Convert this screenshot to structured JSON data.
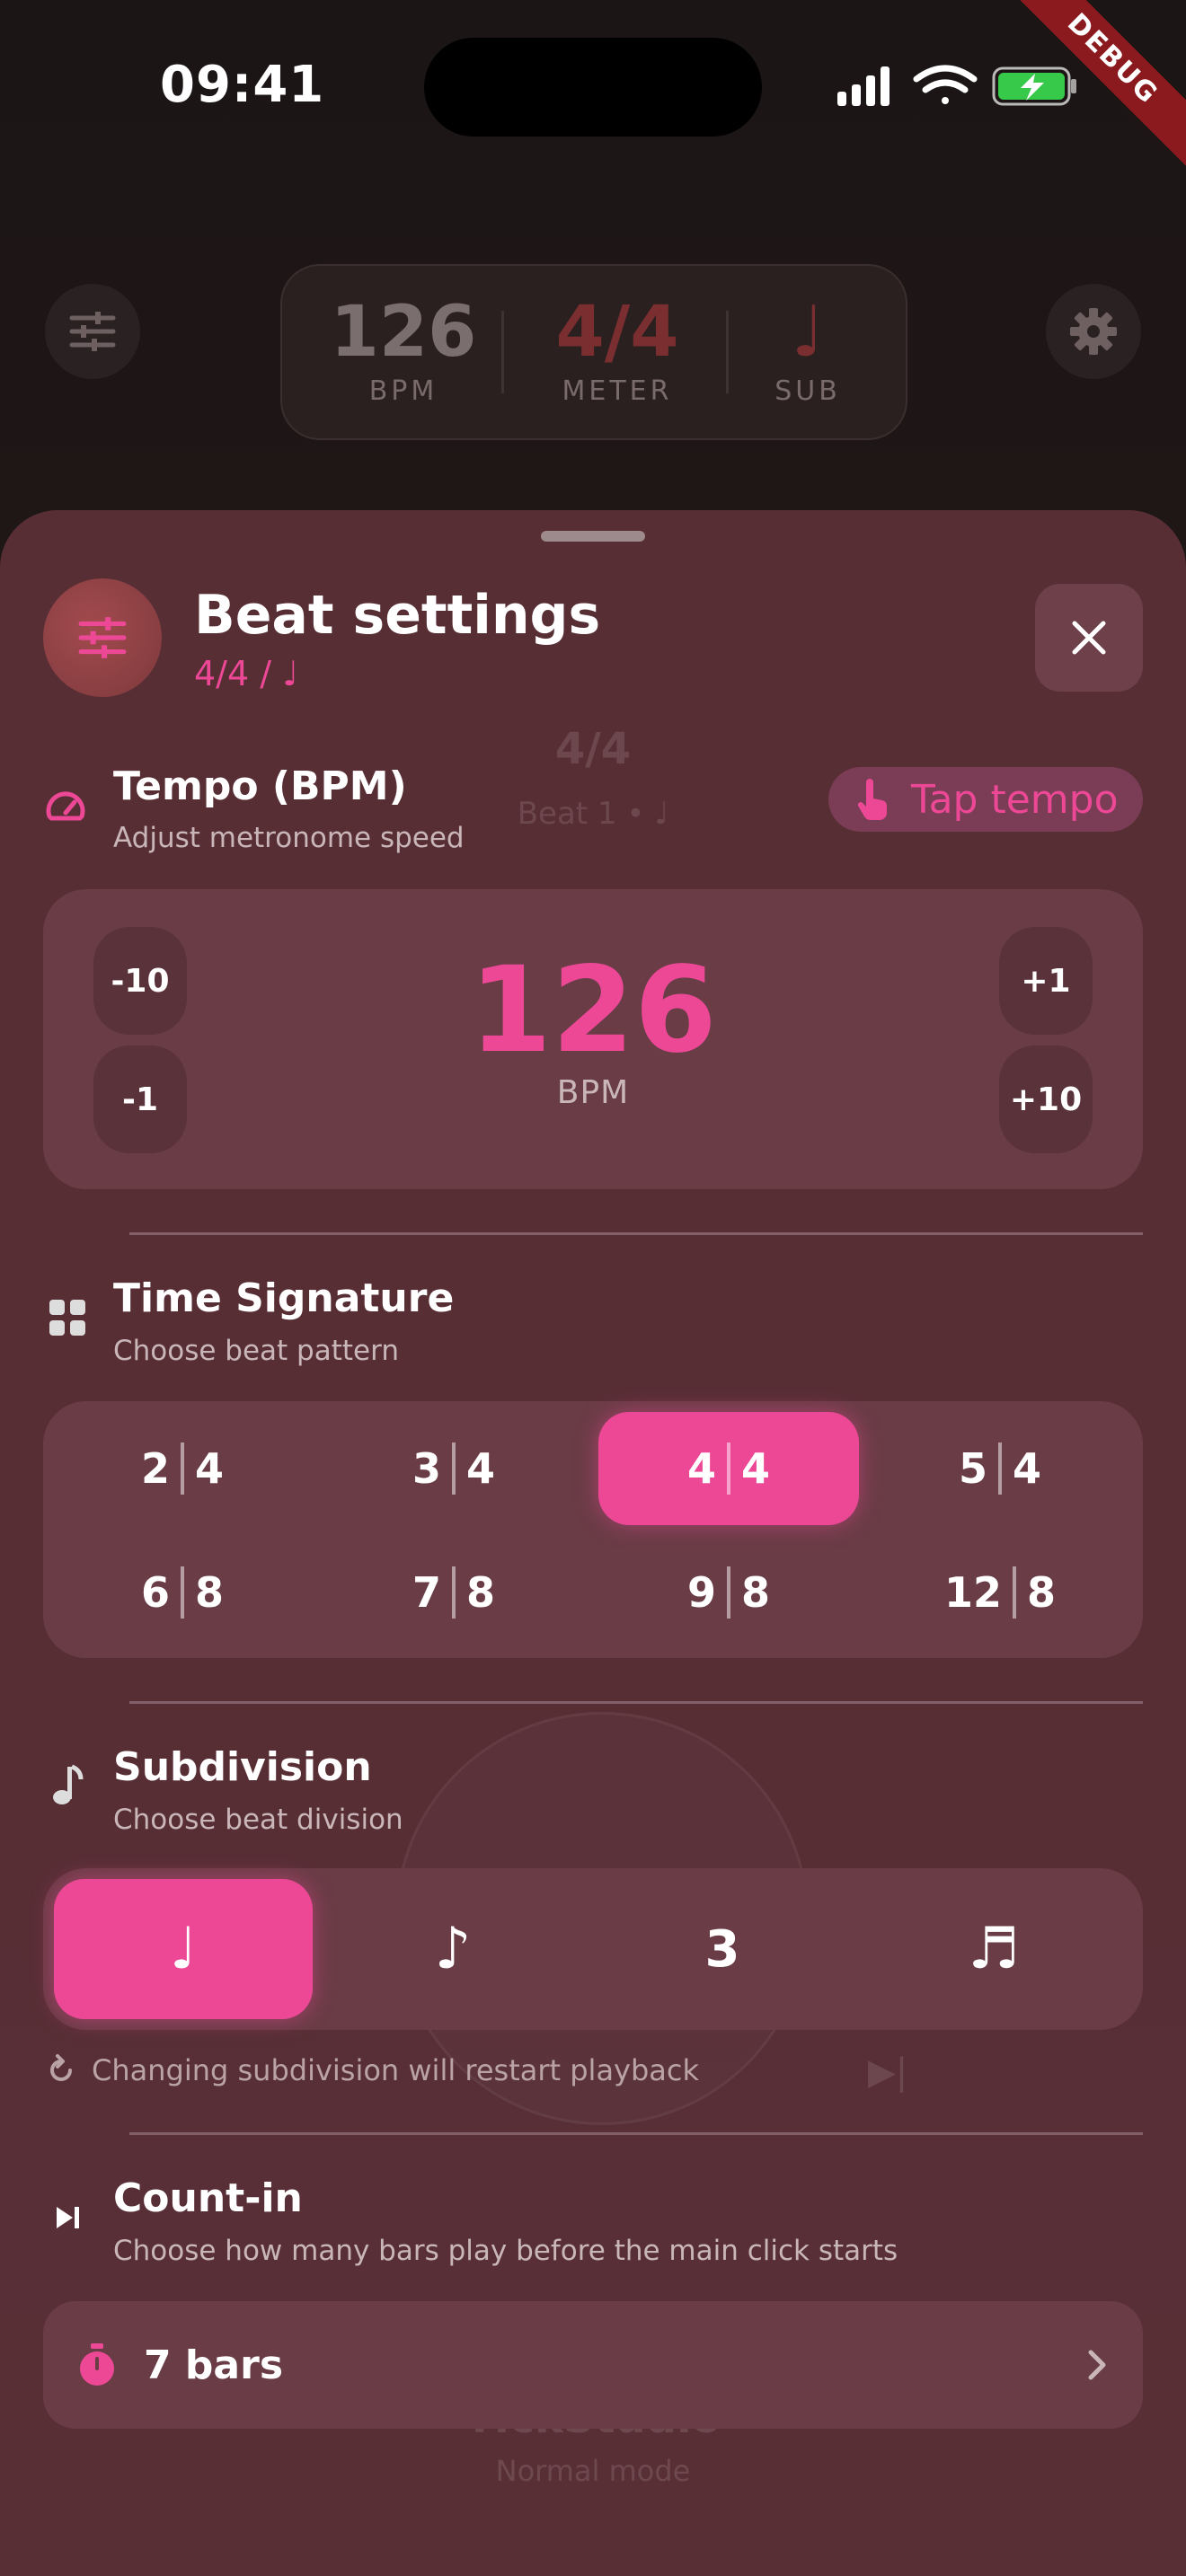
{
  "status_bar": {
    "time": "09:41"
  },
  "debug_banner": "DEBUG",
  "hud": {
    "bpm_value": "126",
    "bpm_label": "BPM",
    "meter_value": "4/4",
    "meter_label": "METER",
    "sub_value": "♩",
    "sub_label": "SUB"
  },
  "background": {
    "meter": "4/4",
    "beat": "Beat 1 • ♩",
    "app_name": "TickStudio",
    "mode": "Normal mode"
  },
  "sheet": {
    "title": "Beat settings",
    "subtitle": "4/4 / ♩",
    "tempo": {
      "title": "Tempo (BPM)",
      "subtitle": "Adjust metronome speed",
      "tap_label": "Tap tempo",
      "value": "126",
      "unit": "BPM",
      "minus10": "-10",
      "minus1": "-1",
      "plus1": "+1",
      "plus10": "+10"
    },
    "time_signature": {
      "title": "Time Signature",
      "subtitle": "Choose beat pattern",
      "options": [
        {
          "top": "2",
          "bottom": "4"
        },
        {
          "top": "3",
          "bottom": "4"
        },
        {
          "top": "4",
          "bottom": "4"
        },
        {
          "top": "5",
          "bottom": "4"
        },
        {
          "top": "6",
          "bottom": "8"
        },
        {
          "top": "7",
          "bottom": "8"
        },
        {
          "top": "9",
          "bottom": "8"
        },
        {
          "top": "12",
          "bottom": "8"
        }
      ],
      "selected": "4/4"
    },
    "subdivision": {
      "title": "Subdivision",
      "subtitle": "Choose beat division",
      "options": [
        "♩",
        "♪",
        "3",
        "♬"
      ],
      "selected": 0,
      "note": "Changing subdivision will restart playback"
    },
    "count_in": {
      "title": "Count-in",
      "subtitle": "Choose how many bars play before the main click starts",
      "value": "7 bars"
    }
  },
  "colors": {
    "accent": "#ec4896",
    "sheet": "#5c3038",
    "panel": "#6a3c46",
    "meter_hud": "#7a2e30"
  }
}
